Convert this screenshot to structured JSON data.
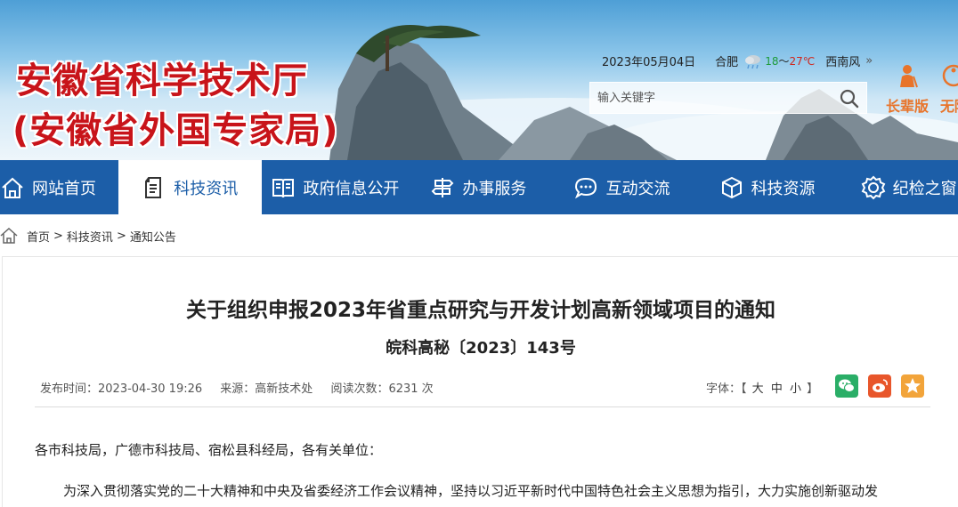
{
  "header": {
    "title_line1": "安徽省科学技术厅",
    "title_line2": "(安徽省外国专家局)",
    "date": "2023年05月04日",
    "city": "合肥",
    "temp_low": "18",
    "temp_sep": "～",
    "temp_high": "27℃",
    "wind": "西南风",
    "more": "»",
    "search_placeholder": "输入关键字",
    "elder_label": "长辈版",
    "barrier_label": "无障",
    "accent_red": "#c8141a",
    "accent_orange": "#e8742a"
  },
  "nav": {
    "color": "#1c5ea8",
    "items": [
      {
        "label": "网站首页",
        "icon": "home-icon"
      },
      {
        "label": "科技资讯",
        "icon": "document-icon"
      },
      {
        "label": "政府信息公开",
        "icon": "book-icon"
      },
      {
        "label": "办事服务",
        "icon": "road-sign-icon"
      },
      {
        "label": "互动交流",
        "icon": "chat-icon"
      },
      {
        "label": "科技资源",
        "icon": "cube-icon"
      },
      {
        "label": "纪检之窗",
        "icon": "badge-icon"
      }
    ]
  },
  "breadcrumb": {
    "items": [
      "首页",
      "科技资讯",
      "通知公告"
    ],
    "sep": ">"
  },
  "article": {
    "title": "关于组织申报2023年省重点研究与开发计划高新领域项目的通知",
    "doc_number": "皖科高秘〔2023〕143号",
    "published": "发布时间：2023-04-30 19:26",
    "source": "来源：高新技术处",
    "views": "阅读次数：6231 次",
    "font_label": "字体：",
    "font_open": "【",
    "font_large": "大",
    "font_medium": "中",
    "font_small": "小",
    "font_close": "】",
    "greeting": "各市科技局，广德市科技局、宿松县科经局，各有关单位：",
    "body_first_line": "为深入贯彻落实党的二十大精神和中央及省委经济工作会议精神，坚持以习近平新时代中国特色社会主义思想为指引，大力实施创新驱动发",
    "share_colors": {
      "wechat": "#2aae67",
      "weibo": "#e8562b",
      "favorite": "#f2a43a"
    }
  }
}
